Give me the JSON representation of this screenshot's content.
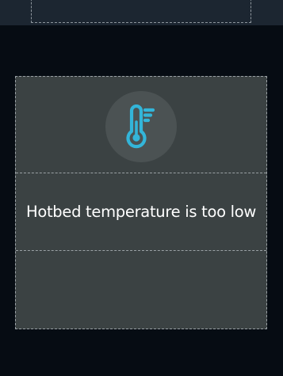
{
  "dialog": {
    "message": "Hotbed temperature is too low",
    "icon": "thermometer-icon"
  },
  "colors": {
    "background": "#060c13",
    "top_bar": "#1c2631",
    "card": "#3b4243",
    "icon_circle": "#4b5253",
    "icon_accent": "#33b5d9",
    "text": "#ffffff"
  }
}
